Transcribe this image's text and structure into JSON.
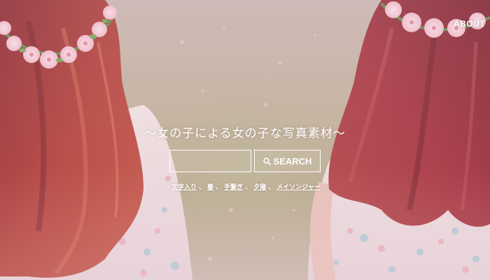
{
  "header": {
    "about_label": "ABOUT"
  },
  "hero": {
    "tagline": "〜女の子による女の子な写真素材〜",
    "search": {
      "value": "",
      "placeholder": "",
      "button_label": "SEARCH"
    },
    "tags": [
      "文字入り",
      "春",
      "手繋ぎ",
      "夕陽",
      "メイソンジャー"
    ],
    "tag_separator": "、"
  },
  "colors": {
    "text": "#ffffff",
    "hair": "#9b2f35",
    "flower": "#f3c8d2"
  },
  "icons": {
    "search_button": "search-icon"
  }
}
